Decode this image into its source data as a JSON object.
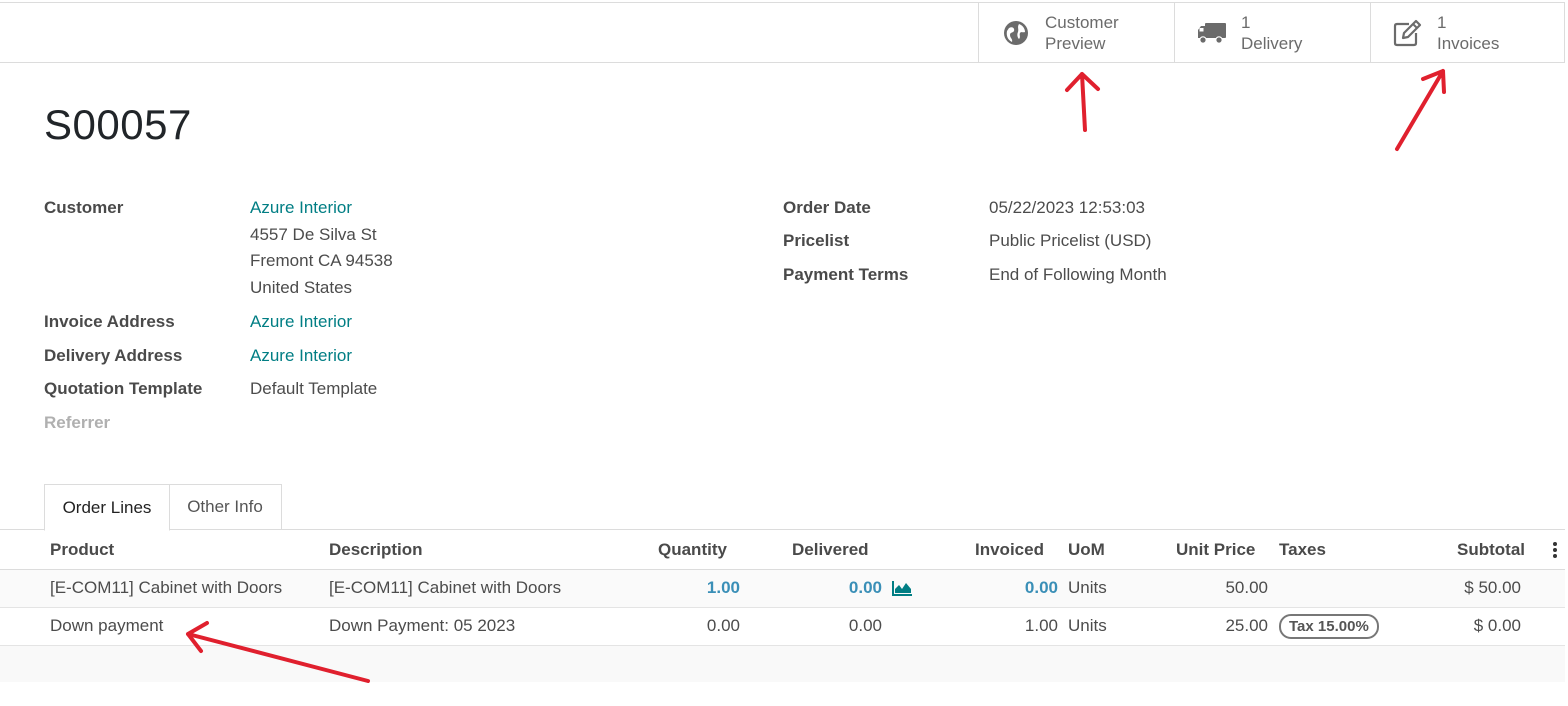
{
  "smart_buttons": {
    "customer_preview": {
      "line1": "Customer",
      "line2": "Preview",
      "icon": "globe-icon"
    },
    "delivery": {
      "count": "1",
      "label": "Delivery",
      "icon": "truck-icon"
    },
    "invoices": {
      "count": "1",
      "label": "Invoices",
      "icon": "pencil-square-icon"
    }
  },
  "record": {
    "name": "S00057"
  },
  "fields_left": {
    "customer_label": "Customer",
    "customer_name": "Azure Interior",
    "address_line1": "4557 De Silva St",
    "address_line2": "Fremont CA 94538",
    "address_line3": "United States",
    "invoice_address_label": "Invoice Address",
    "invoice_address_value": "Azure Interior",
    "delivery_address_label": "Delivery Address",
    "delivery_address_value": "Azure Interior",
    "quotation_template_label": "Quotation Template",
    "quotation_template_value": "Default Template",
    "referrer_label": "Referrer"
  },
  "fields_right": {
    "order_date_label": "Order Date",
    "order_date_value": "05/22/2023 12:53:03",
    "pricelist_label": "Pricelist",
    "pricelist_value": "Public Pricelist (USD)",
    "payment_terms_label": "Payment Terms",
    "payment_terms_value": "End of Following Month"
  },
  "tabs": {
    "order_lines": "Order Lines",
    "other_info": "Other Info"
  },
  "table": {
    "columns": {
      "product": "Product",
      "description": "Description",
      "quantity": "Quantity",
      "delivered": "Delivered",
      "invoiced": "Invoiced",
      "uom": "UoM",
      "unit_price": "Unit Price",
      "taxes": "Taxes",
      "subtotal": "Subtotal"
    },
    "rows": [
      {
        "product": "[E-COM11] Cabinet with Doors",
        "description": "[E-COM11] Cabinet with Doors",
        "quantity": "1.00",
        "delivered": "0.00",
        "invoiced": "0.00",
        "uom": "Units",
        "unit_price": "50.00",
        "taxes": "",
        "subtotal": "$ 50.00"
      },
      {
        "product": "Down payment",
        "description": "Down Payment: 05 2023",
        "quantity": "0.00",
        "delivered": "0.00",
        "invoiced": "1.00",
        "uom": "Units",
        "unit_price": "25.00",
        "taxes": "Tax 15.00%",
        "subtotal": "$ 0.00"
      }
    ]
  },
  "colors": {
    "link": "#017e84",
    "arrow": "#e0202e",
    "qty_link": "#3a8fb7"
  }
}
